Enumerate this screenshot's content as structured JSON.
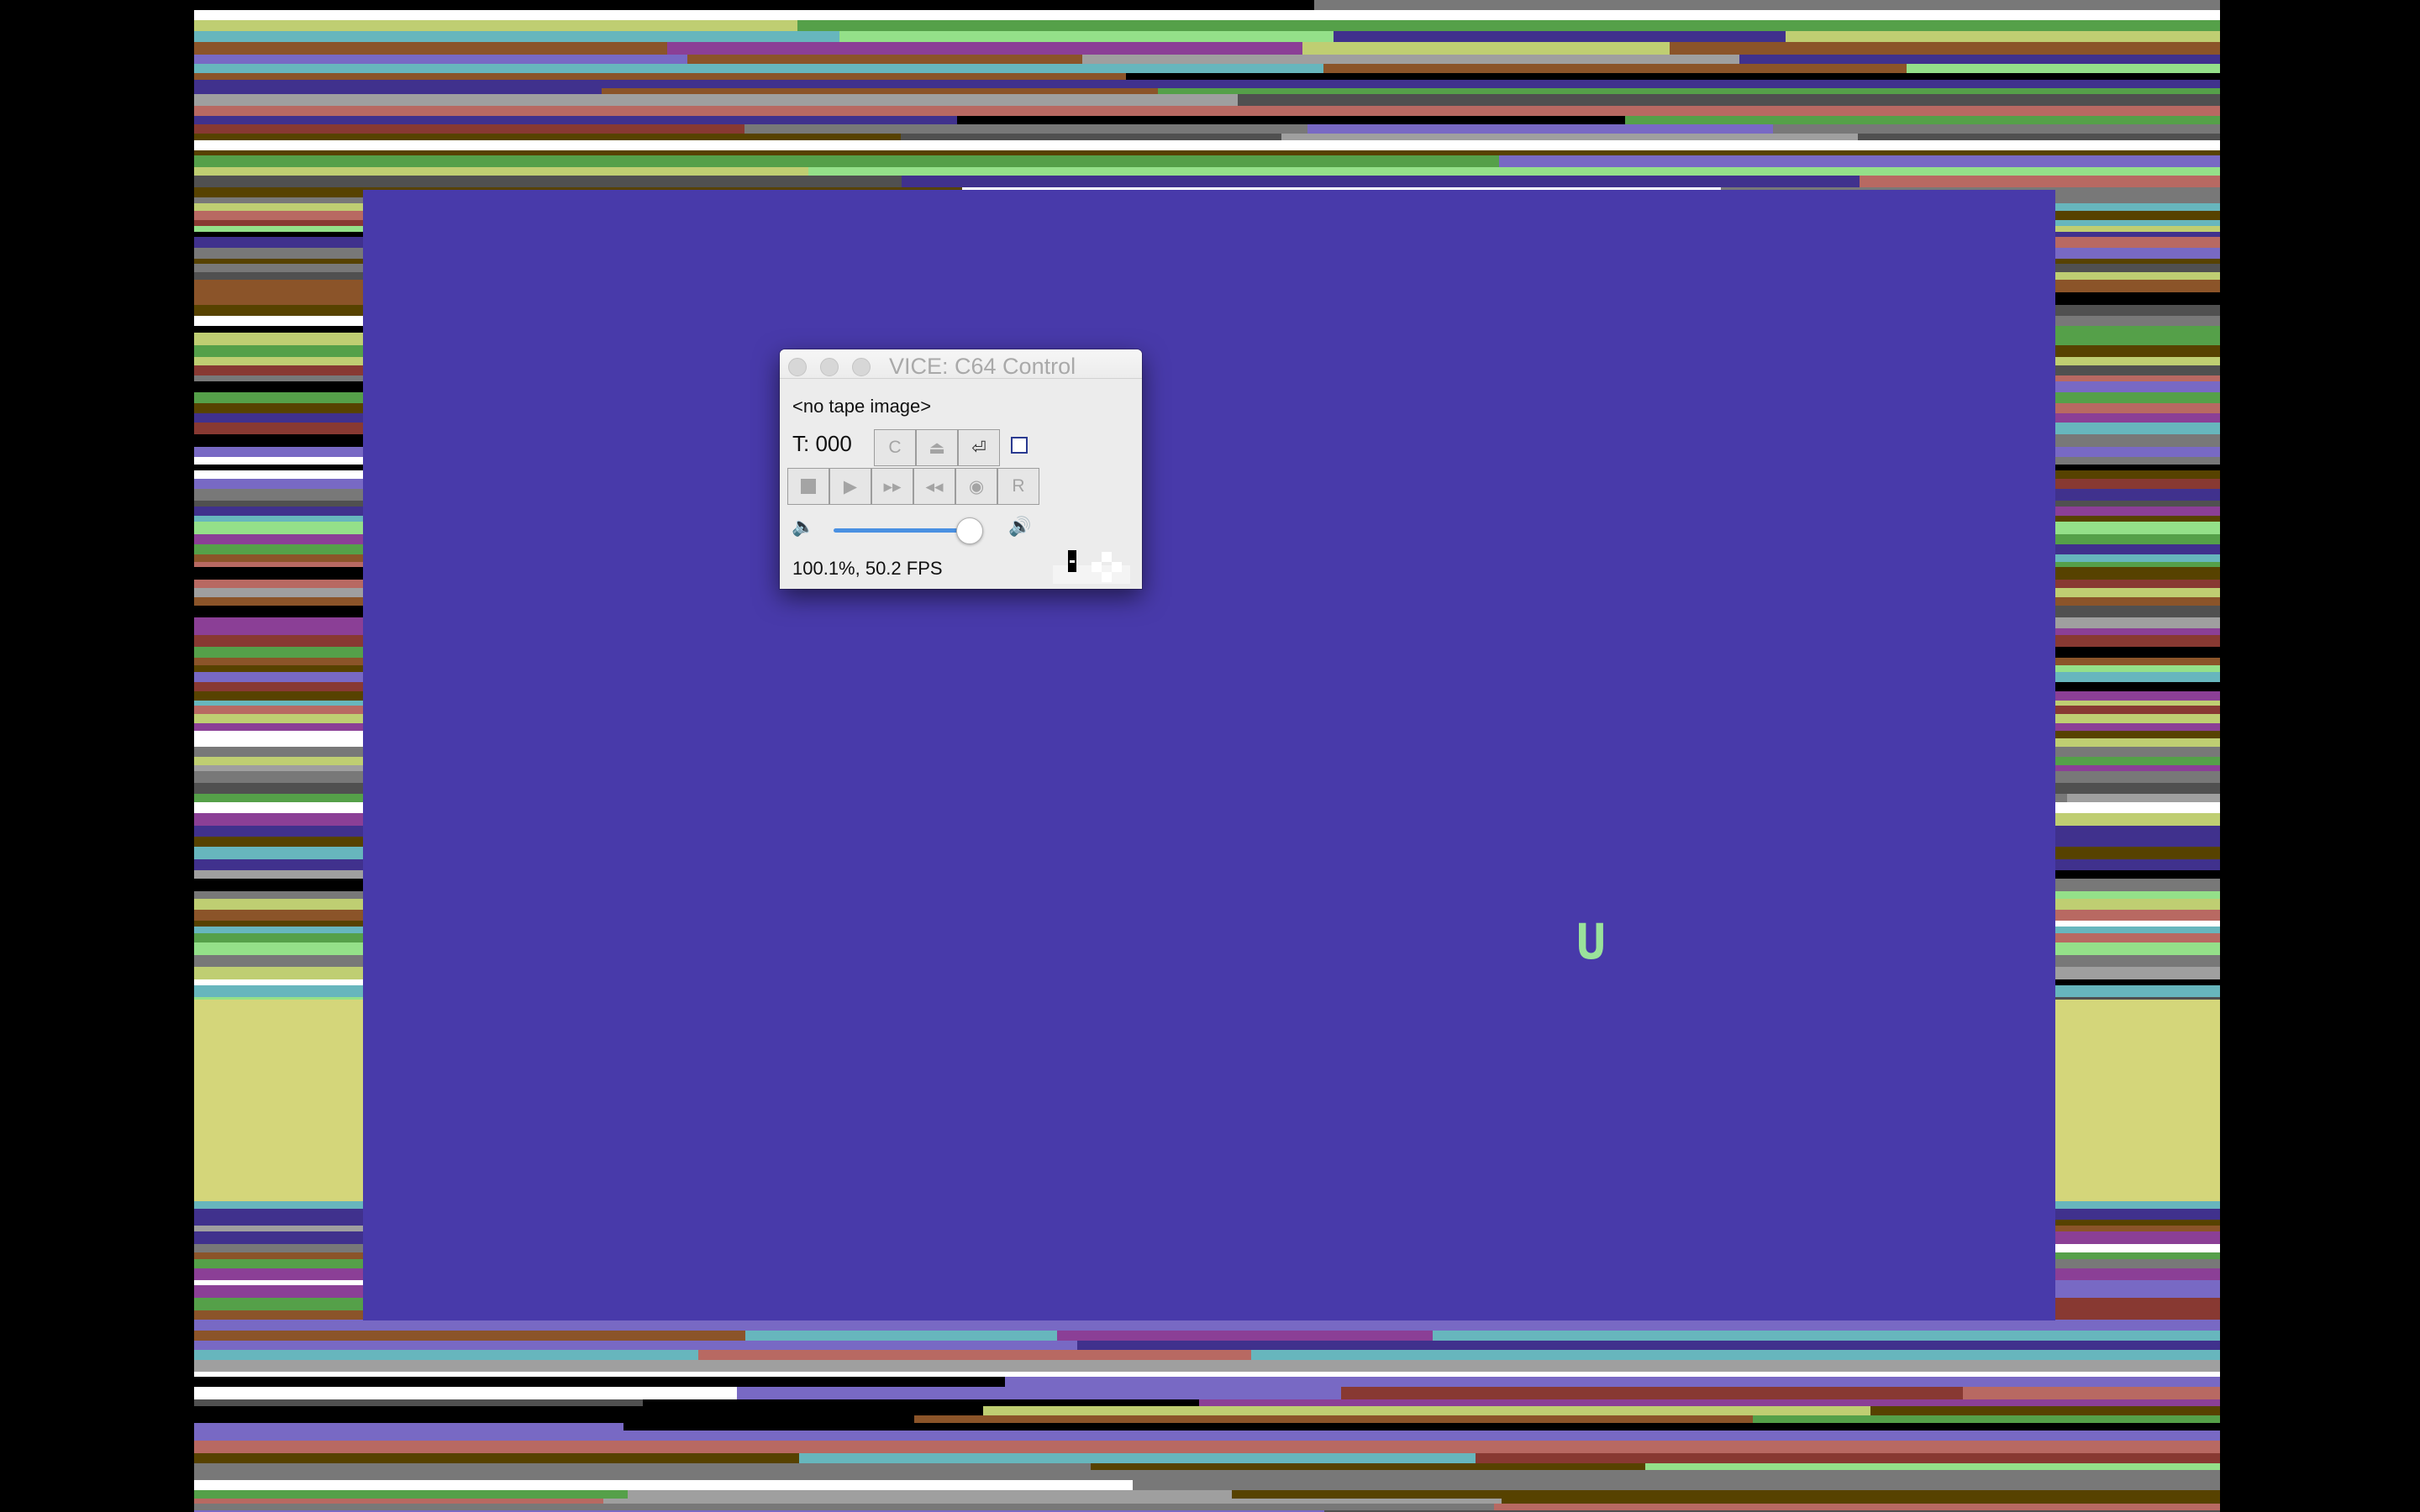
{
  "emulator": {
    "screen_character": "U",
    "colors": {
      "screen": "#483aaa",
      "character": "#9ae29b",
      "border_stripes": [
        "#883932",
        "#67b6bd",
        "#8b3f96",
        "#55a049",
        "#40318d",
        "#bfce72",
        "#8b5429",
        "#574200",
        "#b86962",
        "#505050",
        "#787878",
        "#94e089",
        "#7869c4",
        "#9f9f9f",
        "#ffffff",
        "#000000"
      ]
    }
  },
  "control_window": {
    "title": "VICE: C64 Control",
    "tape_status": "<no tape image>",
    "tape_counter": "T: 000",
    "buttons": {
      "c_label": "C",
      "eject_icon": "⏏",
      "enter_icon": "⏎",
      "stop_icon": "stop-icon",
      "play_icon": "▶",
      "forward_icon": "▸▸",
      "rewind_icon": "◂◂",
      "record_icon": "◉",
      "reset_label": "R"
    },
    "volume": {
      "low_icon": "🔈",
      "high_icon": "🔊",
      "level": 0.95
    },
    "speed_text": "100.1%, 50.2 FPS"
  }
}
